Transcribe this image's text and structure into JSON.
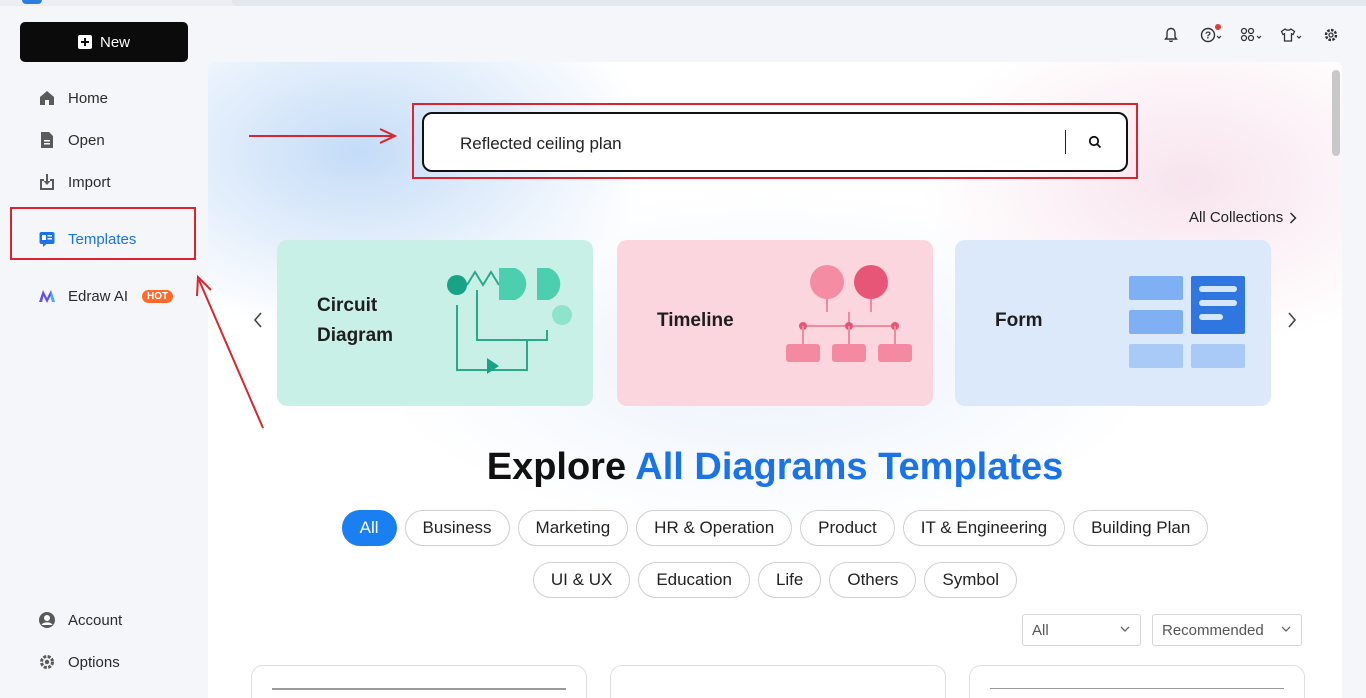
{
  "sidebar": {
    "new_label": "New",
    "items": [
      {
        "label": "Home"
      },
      {
        "label": "Open"
      },
      {
        "label": "Import"
      },
      {
        "label": "Templates"
      },
      {
        "label": "Edraw AI",
        "badge": "HOT"
      }
    ],
    "bottom": [
      {
        "label": "Account"
      },
      {
        "label": "Options"
      }
    ]
  },
  "search": {
    "value": "Reflected ceiling plan"
  },
  "collections": {
    "all_label": "All Collections"
  },
  "cards": [
    {
      "line1": "Circuit",
      "line2": "Diagram"
    },
    {
      "line1": "Timeline"
    },
    {
      "line1": "Form"
    }
  ],
  "explore": {
    "prefix": "Explore",
    "highlight": "All Diagrams Templates"
  },
  "categories": {
    "row1": [
      "All",
      "Business",
      "Marketing",
      "HR & Operation",
      "Product",
      "IT & Engineering",
      "Building Plan"
    ],
    "row2": [
      "UI & UX",
      "Education",
      "Life",
      "Others",
      "Symbol"
    ],
    "active": "All"
  },
  "filters": {
    "type_value": "All",
    "sort_value": "Recommended"
  },
  "colors": {
    "accent": "#1a73e8",
    "annotation": "#d9252d",
    "hot_badge": "#ff6a2b"
  }
}
